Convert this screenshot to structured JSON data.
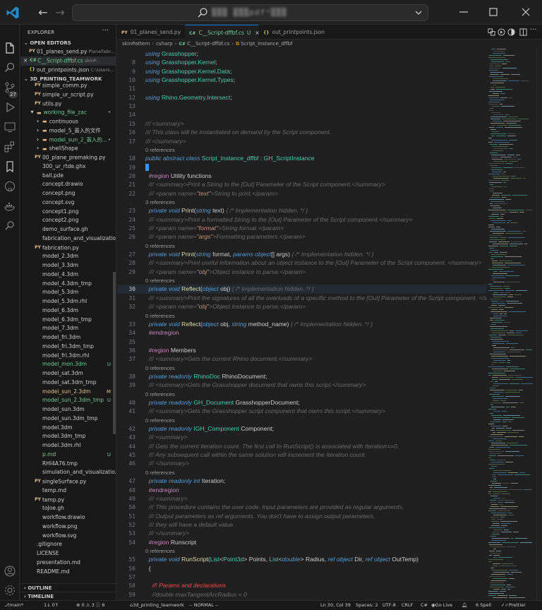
{
  "titlebar": {
    "search_text": "▒▒▒ ▒▒▒pdfᵃ▒▒▒",
    "buttons": [
      "minimize",
      "maximize",
      "close"
    ]
  },
  "activity": {
    "badge": "27",
    "icons": [
      "files-icon",
      "search-icon",
      "source-control-icon",
      "run-debug-icon",
      "remote-explorer-icon",
      "extensions-icon",
      "bookmark-icon",
      "github-icon",
      "docker-icon",
      "search-tree-icon",
      "account-icon",
      "settings-gear-icon"
    ]
  },
  "sidebar": {
    "title": "EXPLORER",
    "more": "···",
    "open_editors_label": "OPEN EDITORS",
    "open_editors": [
      {
        "icon": "PY",
        "name": "01_planes_send.py",
        "desc": "PlaneFabr...",
        "status": ""
      },
      {
        "icon": "C#",
        "name": "C__Script-dffbf.cs",
        "desc": "skinP...",
        "status": "U",
        "close": "×"
      },
      {
        "icon": "{}",
        "name": "out_printpoints.json",
        "desc": "C:\\Users...",
        "status": ""
      }
    ],
    "project_label": "3D_PRINTING_TEAMWORK",
    "files": [
      {
        "icon": "PY",
        "name": "simple_comm.py",
        "indent": 2,
        "status": "",
        "color": "#cccccc"
      },
      {
        "icon": "PY",
        "name": "simple_ur_script.py",
        "indent": 2,
        "status": "",
        "color": "#cccccc"
      },
      {
        "icon": "PY",
        "name": "utils.py",
        "indent": 2,
        "status": "",
        "color": "#cccccc"
      },
      {
        "icon": "▾",
        "name": "working_file_zac",
        "indent": 1,
        "status": "•",
        "color": "#73c991",
        "folder": true
      },
      {
        "icon": "›",
        "name": "continuous",
        "indent": 2,
        "status": "",
        "color": "#cccccc",
        "folder": true
      },
      {
        "icon": "›",
        "name": "model_5_晋入的文件",
        "indent": 2,
        "status": "",
        "color": "#cccccc",
        "folder": true
      },
      {
        "icon": "›",
        "name": "model_sun_2_晋入的...",
        "indent": 2,
        "status": "•",
        "color": "#73c991",
        "folder": true
      },
      {
        "icon": "›",
        "name": "shellShape",
        "indent": 2,
        "status": "",
        "color": "#cccccc",
        "folder": true
      },
      {
        "icon": "PY",
        "name": "00_plane_premaking.py",
        "indent": 2,
        "status": "",
        "color": "#cccccc"
      },
      {
        "icon": "",
        "name": "300_ur_rtde.ghx",
        "indent": 2,
        "status": "",
        "color": "#cccccc"
      },
      {
        "icon": "",
        "name": "ball.pde",
        "indent": 2,
        "status": "",
        "color": "#cccccc"
      },
      {
        "icon": "",
        "name": "concept.drawio",
        "indent": 2,
        "status": "",
        "color": "#cccccc"
      },
      {
        "icon": "",
        "name": "concept.png",
        "indent": 2,
        "status": "",
        "color": "#cccccc"
      },
      {
        "icon": "",
        "name": "concept.svg",
        "indent": 2,
        "status": "",
        "color": "#cccccc"
      },
      {
        "icon": "",
        "name": "concept1.png",
        "indent": 2,
        "status": "",
        "color": "#cccccc"
      },
      {
        "icon": "",
        "name": "concept2.png",
        "indent": 2,
        "status": "",
        "color": "#cccccc"
      },
      {
        "icon": "",
        "name": "demo_surface.gh",
        "indent": 2,
        "status": "",
        "color": "#cccccc"
      },
      {
        "icon": "",
        "name": "fabrication_and_visualization...",
        "indent": 2,
        "status": "",
        "color": "#cccccc"
      },
      {
        "icon": "PY",
        "name": "fabrication.py",
        "indent": 2,
        "status": "",
        "color": "#cccccc"
      },
      {
        "icon": "",
        "name": "model_2.3dm",
        "indent": 2,
        "status": "",
        "color": "#cccccc"
      },
      {
        "icon": "",
        "name": "model_3.3dm",
        "indent": 2,
        "status": "",
        "color": "#cccccc"
      },
      {
        "icon": "",
        "name": "model_4.3dm",
        "indent": 2,
        "status": "",
        "color": "#cccccc"
      },
      {
        "icon": "",
        "name": "model_4.3dm_tmp",
        "indent": 2,
        "status": "",
        "color": "#cccccc"
      },
      {
        "icon": "",
        "name": "model_5.3dm",
        "indent": 2,
        "status": "",
        "color": "#cccccc"
      },
      {
        "icon": "",
        "name": "model_5.3dm.rhl",
        "indent": 2,
        "status": "",
        "color": "#cccccc"
      },
      {
        "icon": "",
        "name": "model_6.3dm",
        "indent": 2,
        "status": "",
        "color": "#cccccc"
      },
      {
        "icon": "",
        "name": "model_6.3dm_tmp",
        "indent": 2,
        "status": "",
        "color": "#cccccc"
      },
      {
        "icon": "",
        "name": "model_7.3dm",
        "indent": 2,
        "status": "",
        "color": "#cccccc"
      },
      {
        "icon": "",
        "name": "model_fri.3dm",
        "indent": 2,
        "status": "",
        "color": "#cccccc"
      },
      {
        "icon": "",
        "name": "model_fri.3dm_tmp",
        "indent": 2,
        "status": "",
        "color": "#cccccc"
      },
      {
        "icon": "",
        "name": "model_fri.3dm.rhl",
        "indent": 2,
        "status": "",
        "color": "#cccccc"
      },
      {
        "icon": "",
        "name": "model_mon.3dm",
        "indent": 2,
        "status": "U",
        "color": "#73c991"
      },
      {
        "icon": "",
        "name": "model_sat.3dm",
        "indent": 2,
        "status": "",
        "color": "#cccccc"
      },
      {
        "icon": "",
        "name": "model_sat.3dm_tmp",
        "indent": 2,
        "status": "",
        "color": "#cccccc"
      },
      {
        "icon": "",
        "name": "model_sun_2.3dm",
        "indent": 2,
        "status": "M",
        "color": "#e2c08d"
      },
      {
        "icon": "",
        "name": "model_sun_2.3dm_tmp",
        "indent": 2,
        "status": "U",
        "color": "#73c991"
      },
      {
        "icon": "",
        "name": "model_sun.3dm",
        "indent": 2,
        "status": "",
        "color": "#cccccc"
      },
      {
        "icon": "",
        "name": "model_sun.3dm_tmp",
        "indent": 2,
        "status": "",
        "color": "#cccccc"
      },
      {
        "icon": "",
        "name": "model.3dm",
        "indent": 2,
        "status": "",
        "color": "#cccccc"
      },
      {
        "icon": "",
        "name": "model.3dm_tmp",
        "indent": 2,
        "status": "",
        "color": "#cccccc"
      },
      {
        "icon": "",
        "name": "model.3dm.rhl",
        "indent": 2,
        "status": "",
        "color": "#cccccc"
      },
      {
        "icon": "",
        "name": "p.md",
        "indent": 2,
        "status": "U",
        "color": "#73c991"
      },
      {
        "icon": "",
        "name": "RHI4A76.tmp",
        "indent": 2,
        "status": "",
        "color": "#cccccc"
      },
      {
        "icon": "",
        "name": "simulation_and_visualizatio...",
        "indent": 2,
        "status": "",
        "color": "#cccccc"
      },
      {
        "icon": "PY",
        "name": "singleSurface.py",
        "indent": 2,
        "status": "",
        "color": "#cccccc"
      },
      {
        "icon": "",
        "name": "temp.md",
        "indent": 2,
        "status": "",
        "color": "#cccccc"
      },
      {
        "icon": "PY",
        "name": "temp.py",
        "indent": 2,
        "status": "",
        "color": "#cccccc"
      },
      {
        "icon": "",
        "name": "toJoe.gh",
        "indent": 2,
        "status": "",
        "color": "#cccccc"
      },
      {
        "icon": "",
        "name": "workflow.drawio",
        "indent": 2,
        "status": "",
        "color": "#cccccc"
      },
      {
        "icon": "",
        "name": "workflow.png",
        "indent": 2,
        "status": "",
        "color": "#cccccc"
      },
      {
        "icon": "",
        "name": "workflow.svg",
        "indent": 2,
        "status": "",
        "color": "#cccccc"
      },
      {
        "icon": "",
        "name": ".gitignore",
        "indent": 1,
        "status": "",
        "color": "#cccccc"
      },
      {
        "icon": "",
        "name": "LICENSE",
        "indent": 1,
        "status": "",
        "color": "#cccccc"
      },
      {
        "icon": "",
        "name": "presentation.md",
        "indent": 1,
        "status": "",
        "color": "#cccccc"
      },
      {
        "icon": "",
        "name": "README.md",
        "indent": 1,
        "status": "",
        "color": "#cccccc"
      }
    ],
    "outline_label": "OUTLINE",
    "timeline_label": "TIMELINE"
  },
  "tabs": [
    {
      "icon": "PY",
      "label": "01_planes_send.py",
      "active": false,
      "mod": "",
      "close": ""
    },
    {
      "icon": "C#",
      "label": "C__Script-dffbf.cs",
      "active": true,
      "mod": "U",
      "close": "×"
    },
    {
      "icon": "{}",
      "label": "out_printpoints.json",
      "active": false,
      "mod": "",
      "close": ""
    }
  ],
  "breadcrumb": [
    "skinPattern",
    "csharp",
    "C__Script-dffbf.cs",
    "Script_Instance_dffbf"
  ],
  "editor": {
    "current_line": "30",
    "lines": [
      {
        "n": "",
        "html": "<span class='kw'>using</span> <span class='ty'>Grasshopper</span>;"
      },
      {
        "n": "8",
        "html": "<span class='kw'>using</span> <span class='ty'>Grasshopper</span>.<span class='ty'>Kernel</span>;"
      },
      {
        "n": "9",
        "html": "<span class='kw'>using</span> <span class='ty'>Grasshopper</span>.<span class='ty'>Kernel</span>.<span class='ty'>Data</span>;"
      },
      {
        "n": "10",
        "html": "<span class='kw'>using</span> <span class='ty'>Grasshopper</span>.<span class='ty'>Kernel</span>.<span class='ty'>Types</span>;"
      },
      {
        "n": "11",
        "html": ""
      },
      {
        "n": "12",
        "html": "<span class='kw'>using</span> <span class='ty'>Rhino</span>.<span class='ty'>Geometry</span>.<span class='ty'>Intersect</span>;"
      },
      {
        "n": "13",
        "html": ""
      },
      {
        "n": "14",
        "html": ""
      },
      {
        "n": "15",
        "html": "<span class='dc'>/// &lt;summary&gt;</span>"
      },
      {
        "n": "16",
        "html": "<span class='dc'>/// This class will be instantiated on demand by the Script component.</span>"
      },
      {
        "n": "17",
        "html": "<span class='dc'>/// &lt;/summary&gt;</span>"
      },
      {
        "lens": "0 references"
      },
      {
        "n": "18",
        "html": "<span class='kw'>public abstract class</span> <span class='ty'>Script_Instance_dffbf</span> : <span class='ty'>GH_ScriptInstance</span>"
      },
      {
        "n": "19",
        "html": "<span class='cursor'></span>"
      },
      {
        "n": "20",
        "html": "  <span class='rg'>#region</span> Utility functions"
      },
      {
        "n": "21",
        "html": "  <span class='dc'>/// &lt;summary&gt;Print a String to the [Out] Parameter of the Script component.&lt;/summary&gt;</span>"
      },
      {
        "n": "22",
        "html": "  <span class='dc'>/// &lt;param name=<span class='st2'>\"text\"</span>&gt;String to print.&lt;/param&gt;</span>"
      },
      {
        "lens": "  3 references"
      },
      {
        "n": "23",
        "html": "  <span class='kw'>private void</span> <span class='fn'>Print</span>(<span class='kw'>string</span> text) <span class='dc'>{ /* Implementation hidden. */ }</span>"
      },
      {
        "n": "24",
        "html": "  <span class='dc'>/// &lt;summary&gt;Print a formatted String to the [Out] Parameter of the Script component.&lt;/summary&gt;</span>"
      },
      {
        "n": "25",
        "html": "  <span class='dc'>/// &lt;param name=<span class='st2'>\"format\"</span>&gt;String format.&lt;/param&gt;</span>"
      },
      {
        "n": "26",
        "html": "  <span class='dc'>/// &lt;param name=<span class='st2'>\"args\"</span>&gt;Formatting parameters.&lt;/param&gt;</span>"
      },
      {
        "lens": "  0 references"
      },
      {
        "n": "27",
        "html": "  <span class='kw'>private void</span> <span class='fn'>Print</span>(<span class='kw'>string</span> format, <span class='kw'>params object</span>[] args) <span class='dc'>{ /* Implementation hidden. */ }</span>"
      },
      {
        "n": "28",
        "html": "  <span class='dc'>/// &lt;summary&gt;Print useful information about an object instance to the [Out] Parameter of the Script component. &lt;/summary&gt;</span>"
      },
      {
        "n": "29",
        "html": "  <span class='dc'>/// &lt;param name=<span class='st2'>\"obj\"</span>&gt;Object instance to parse.&lt;/param&gt;</span>"
      },
      {
        "lens": "  0 references"
      },
      {
        "n": "30",
        "html": "  <span class='kw'>private void</span> <span class='fn'>Reflect</span>(<span class='kw'>object</span> obj) <span class='dc'>{ /* Implementation hidden. */ }</span>"
      },
      {
        "n": "31",
        "html": "  <span class='dc'>/// &lt;summary&gt;Print the signatures of all the overloads of a specific method to the [Out] Parameter of the Script component. &lt;/su</span>"
      },
      {
        "n": "32",
        "html": "  <span class='dc'>/// &lt;param name=<span class='st2'>\"obj\"</span>&gt;Object instance to parse.&lt;/param&gt;</span>"
      },
      {
        "lens": "  0 references"
      },
      {
        "n": "33",
        "html": "  <span class='kw'>private void</span> <span class='fn'>Reflect</span>(<span class='kw'>object</span> obj, <span class='kw'>string</span> method_name) <span class='dc'>{ /* Implementation hidden. */ }</span>"
      },
      {
        "n": "34",
        "html": "  <span class='rg'>#endregion</span>"
      },
      {
        "n": "35",
        "html": ""
      },
      {
        "n": "36",
        "html": "  <span class='rg'>#region</span> Members"
      },
      {
        "n": "37",
        "html": "  <span class='dc'>/// &lt;summary&gt;Gets the current Rhino document.&lt;/summary&gt;</span>"
      },
      {
        "lens": "  0 references"
      },
      {
        "n": "38",
        "html": "  <span class='kw'>private readonly</span> <span class='ty'>RhinoDoc</span> RhinoDocument;"
      },
      {
        "n": "39",
        "html": "  <span class='dc'>/// &lt;summary&gt;Gets the Grasshopper document that owns this script.&lt;/summary&gt;</span>"
      },
      {
        "lens": "  0 references"
      },
      {
        "n": "40",
        "html": "  <span class='kw'>private readonly</span> <span class='ty'>GH_Document</span> GrasshopperDocument;"
      },
      {
        "n": "41",
        "html": "  <span class='dc'>/// &lt;summary&gt;Gets the Grasshopper script component that owns this script.&lt;/summary&gt;</span>"
      },
      {
        "lens": "  0 references"
      },
      {
        "n": "42",
        "html": "  <span class='kw'>private readonly</span> <span class='ty'>IGH_Component</span> Component;"
      },
      {
        "n": "43",
        "html": "  <span class='dc'>/// &lt;summary&gt;</span>"
      },
      {
        "n": "44",
        "html": "  <span class='dc'>/// Gets the current iteration count. The first call to RunScript() is associated with Iteration==0.</span>"
      },
      {
        "n": "45",
        "html": "  <span class='dc'>/// Any subsequent call within the same solution will increment the Iteration count.</span>"
      },
      {
        "n": "46",
        "html": "  <span class='dc'>/// &lt;/summary&gt;</span>"
      },
      {
        "lens": "  0 references"
      },
      {
        "n": "47",
        "html": "  <span class='kw'>private readonly int</span> Iteration;"
      },
      {
        "n": "48",
        "html": "  <span class='rg'>#endregion</span>"
      },
      {
        "n": "49",
        "html": "  <span class='dc'>/// &lt;summary&gt;</span>"
      },
      {
        "n": "50",
        "html": "  <span class='dc'>/// This procedure contains the user code. Input parameters are provided as regular arguments,</span>"
      },
      {
        "n": "51",
        "html": "  <span class='dc'>/// Output parameters as ref arguments. You don't have to assign output parameters,</span>"
      },
      {
        "n": "52",
        "html": "  <span class='dc'>/// they will have a default value.</span>"
      },
      {
        "n": "53",
        "html": "  <span class='dc'>/// &lt;/summary&gt;</span>"
      },
      {
        "n": "54",
        "html": "  <span class='rg'>#region</span> Runscript"
      },
      {
        "lens": "  0 references"
      },
      {
        "n": "55",
        "html": "  <span class='kw'>private void</span> <span class='fn'>RunScript</span>(<span class='ty'>List</span>&lt;<span class='ty'>Point3d</span>&gt; Points, <span class='ty'>List</span>&lt;<span class='kw'>double</span>&gt; Radius, <span class='kw'>ref object</span> Dir, <span class='kw'>ref object</span> OutTemp)"
      },
      {
        "n": "56",
        "html": "  {"
      },
      {
        "n": "57",
        "html": ""
      },
      {
        "n": "58",
        "html": "    <span class='red'>//! Params and declarations</span>"
      },
      {
        "n": "59",
        "html": "    <span class='dc'>//double maxTangentArcRadius = 0</span>"
      }
    ]
  },
  "statusbar": {
    "branch": "main*",
    "sync": "1↓ 0↑",
    "problems": "⊗ 0 ⚠ 3 ⓘ 6",
    "workspace": "3d_printing_teamwork",
    "mode": "-- NORMAL --",
    "position": "Ln 30, Col 39",
    "spaces": "Spaces: 2",
    "encoding": "UTF-8",
    "eol": "CRLF",
    "language": "C#",
    "golive": "Go Live",
    "spell": "6 Spell",
    "prettier": "Prettier"
  }
}
